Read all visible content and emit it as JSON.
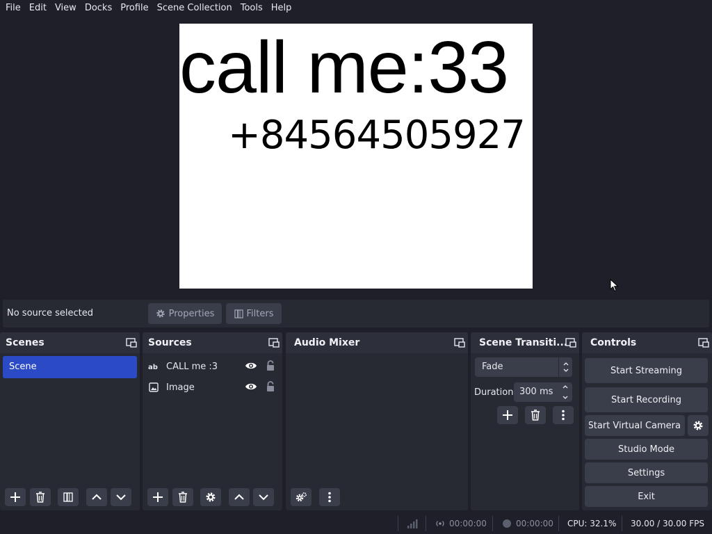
{
  "menu": [
    "File",
    "Edit",
    "View",
    "Docks",
    "Profile",
    "Scene Collection",
    "Tools",
    "Help"
  ],
  "preview": {
    "text_line1": "call me:33",
    "text_line2": "+84564505927"
  },
  "source_toolbar": {
    "status": "No source selected",
    "properties_label": "Properties",
    "filters_label": "Filters"
  },
  "scenes": {
    "title": "Scenes",
    "items": [
      "Scene"
    ]
  },
  "sources": {
    "title": "Sources",
    "items": [
      {
        "label": "CALL me :3",
        "icon": "text-icon"
      },
      {
        "label": "Image",
        "icon": "image-icon"
      }
    ]
  },
  "audio_mixer": {
    "title": "Audio Mixer"
  },
  "transitions": {
    "title": "Scene Transiti...",
    "selected": "Fade",
    "duration_label": "Duration",
    "duration_value": "300 ms"
  },
  "controls": {
    "title": "Controls",
    "start_streaming": "Start Streaming",
    "start_recording": "Start Recording",
    "start_virtual_camera": "Start Virtual Camera",
    "studio_mode": "Studio Mode",
    "settings": "Settings",
    "exit": "Exit"
  },
  "status": {
    "stream_time": "00:00:00",
    "record_time": "00:00:00",
    "cpu": "CPU: 32.1%",
    "fps": "30.00 / 30.00 FPS"
  }
}
